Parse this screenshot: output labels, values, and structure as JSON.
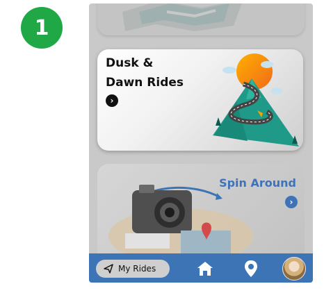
{
  "step": {
    "number": "1"
  },
  "cards": {
    "dusk": {
      "title": "Dusk &\nDawn Rides",
      "arrow": "›"
    },
    "spin": {
      "title": "Spin Around",
      "arrow": "›"
    }
  },
  "nav": {
    "my_rides_label": "My Rides",
    "icons": [
      "send-icon",
      "home-icon",
      "location-pin-icon",
      "profile-avatar"
    ]
  },
  "colors": {
    "badge": "#1fa845",
    "accent_blue": "#3d74b6",
    "spin_title": "#3f73b7",
    "overlay_gray": "#c9c9c9"
  }
}
